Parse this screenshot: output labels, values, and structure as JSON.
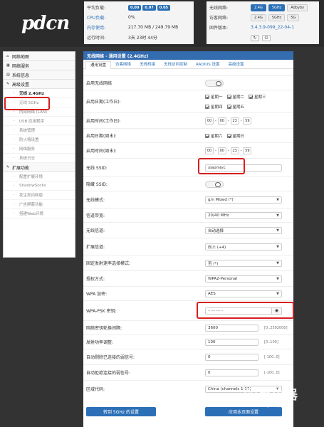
{
  "logo": "pdcn",
  "status_left": [
    {
      "label": "平均负载:",
      "badges": [
        "0.00",
        "0.07",
        "0.05"
      ]
    },
    {
      "label": "CPU负载:",
      "value": "0%"
    },
    {
      "label": "内存使用:",
      "value": "217.70 MB / 249.79 MB"
    },
    {
      "label": "运行时间:",
      "value": "3天 23时 44分"
    }
  ],
  "status_right": {
    "row1_label": "无线网络:",
    "row1_pills": [
      "2.4G",
      "5GHz",
      "Adbyby"
    ],
    "row2_label": "访客网络:",
    "row2_pills": [
      "2.4G",
      "5GHz",
      "5G"
    ],
    "row3_label": "固件版本:",
    "row3_value": "3.4.3.9-099_22-04-1",
    "row4_icons": [
      "refresh-icon",
      "power-icon"
    ]
  },
  "sidebar": {
    "groups": [
      {
        "label": "网络地图",
        "icon": "home-icon"
      },
      {
        "label": "网络服务",
        "icon": "grid-icon"
      },
      {
        "label": "系统信息",
        "icon": "info-icon"
      },
      {
        "label": "高级设置",
        "icon": "wrench-icon"
      }
    ],
    "advanced_items": [
      "无线 2.4GHz",
      "无线 5GHz",
      "内部网络 (LAN)",
      "USB 应用程序",
      "系统管理",
      "防火墙设置",
      "网络服务",
      "系统日志"
    ],
    "ext_group": {
      "label": "扩展功能",
      "icon": "wrench-icon"
    },
    "ext_items": [
      "配置扩展环境",
      "ShadowSocks",
      "花生壳内网版",
      "广告屏蔽功能",
      "搭建Web环境"
    ]
  },
  "main": {
    "title": "无线网络 - 通用设置 (2.4GHz)",
    "tabs": [
      "通用设置",
      "访客网络",
      "无线桥接",
      "无线访问控制",
      "RADIUS 设置",
      "高级设置"
    ],
    "rows": {
      "enable_wireless": "启用无线网络",
      "weekdays_label": "启用日期(工作日):",
      "weekdays": [
        "星期一",
        "星期二",
        "星期三",
        "星期四",
        "星期五"
      ],
      "weekday_time_label": "启用时间(工作日):",
      "weekday_time": [
        "00",
        "00",
        "23",
        "59"
      ],
      "weekend_label": "启用日期(周末):",
      "weekend": [
        "星期六",
        "星期日"
      ],
      "weekend_time_label": "启用时间(周末):",
      "weekend_time": [
        "00",
        "00",
        "23",
        "59"
      ],
      "ssid_label": "无线 SSID:",
      "ssid_value": "xiaomiyc",
      "hide_ssid_label": "隐藏 SSID:",
      "mode_label": "无线模式:",
      "mode_value": "g/n Mixed (*)",
      "bandwidth_label": "信道带宽:",
      "bandwidth_value": "20/40 MHz",
      "channel_label": "无线信道:",
      "channel_value": "自动选择",
      "ext_channel_label": "扩展信道:",
      "ext_channel_value": "向上 (+4)",
      "fixed_rate_label": "固定发射速率选择模式:",
      "fixed_rate_value": "否 (*)",
      "auth_label": "授权方式:",
      "auth_value": "WPA2-Personal",
      "wpa_enc_label": "WPA 加密:",
      "wpa_enc_value": "AES",
      "psk_label": "WPA-PSK 密钥:",
      "psk_value": "············",
      "group_key_label": "网络密钥轮换间隔:",
      "group_key_value": "3600",
      "group_key_hint": "[0..2592000]",
      "txpower_label": "发射功率调整:",
      "txpower_value": "100",
      "txpower_hint": "[0..100]",
      "kick_rssi_label": "自动剔除已连接的弱信号:",
      "kick_rssi_value": "0",
      "kick_rssi_hint": "[-100..0]",
      "reject_rssi_label": "自动拒绝连接的弱信号:",
      "reject_rssi_value": "0",
      "reject_rssi_hint": "[-100..0]",
      "region_label": "区域代码:",
      "region_value": "China (channels 1-13)"
    },
    "btn_goto5g": "转到 5GHz 的设置",
    "btn_apply": "应用本页面设置"
  },
  "watermark": {
    "title": "路由器",
    "sub": "luyouqi.com"
  },
  "colors": {
    "accent": "#2b6fb6",
    "highlight": "#d71f1f"
  }
}
